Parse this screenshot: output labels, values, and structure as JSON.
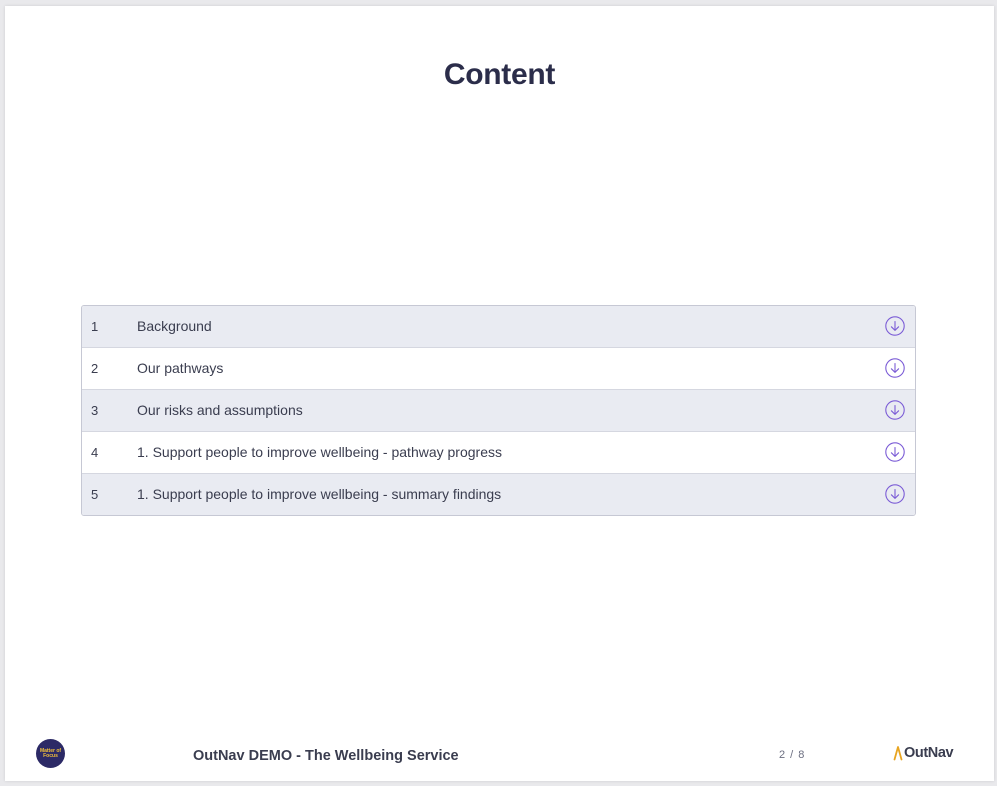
{
  "slide": {
    "title": "Content"
  },
  "toc": {
    "items": [
      {
        "number": "1",
        "label": "Background",
        "icon": "arrow-down-circle-icon"
      },
      {
        "number": "2",
        "label": "Our pathways",
        "icon": "arrow-down-circle-icon"
      },
      {
        "number": "3",
        "label": "Our risks and assumptions",
        "icon": "arrow-down-circle-icon"
      },
      {
        "number": "4",
        "label": "1. Support people to improve wellbeing - pathway progress",
        "icon": "arrow-down-circle-icon"
      },
      {
        "number": "5",
        "label": "1. Support people to improve wellbeing - summary findings",
        "icon": "arrow-down-circle-icon"
      }
    ]
  },
  "footer": {
    "logo_text": "Matter of Focus",
    "title": "OutNav DEMO - The Wellbeing Service",
    "page_indicator": "2 / 8",
    "brand_name": "OutNav"
  },
  "colors": {
    "accent": "#7b5cd6",
    "row_shaded": "#e9ebf2",
    "title_text": "#2b2d4a",
    "logo_bg": "#2c2a66",
    "logo_text": "#f3c23a",
    "brand_mark": "#e8a521"
  }
}
